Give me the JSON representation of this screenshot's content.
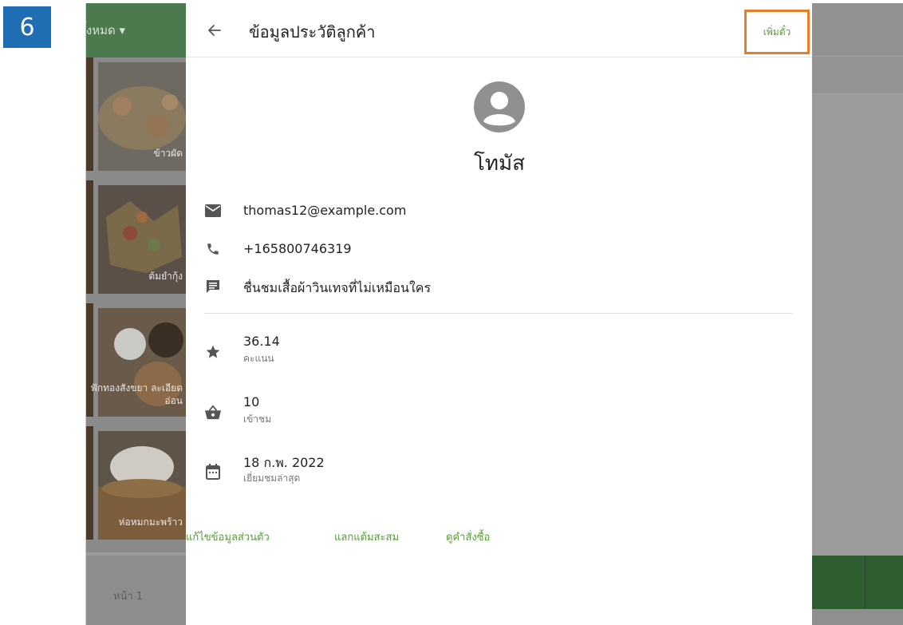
{
  "step": {
    "number": "6"
  },
  "background": {
    "category_label": "ทั้งหมด ▾",
    "menu_items": [
      {
        "label": "ข้าวผัด"
      },
      {
        "label": "ต้มยำกุ้ง"
      },
      {
        "label": "ฟักทองสังขยา ละเอียดอ่อน"
      },
      {
        "label": "ห่อหมกมะพร้าว"
      }
    ],
    "page_label": "หน้า 1"
  },
  "panel": {
    "title": "ข้อมูลประวัติลูกค้า",
    "add_button": "เพิ่มตั๋ว",
    "customer": {
      "name": "โทมัส",
      "email": "thomas12@example.com",
      "phone": "+165800746319",
      "note": "ชื่นชมเสื้อผ้าวินเทจที่ไม่เหมือนใคร"
    },
    "stats": [
      {
        "value": "36.14",
        "label": "คะแนน",
        "icon": "star-icon"
      },
      {
        "value": "10",
        "label": "เข้าชม",
        "icon": "basket-icon"
      },
      {
        "value": "18 ก.พ. 2022",
        "label": "เยี่ยมชมล่าสุด",
        "icon": "calendar-icon"
      }
    ],
    "actions": {
      "edit": "แก้ไขข้อมูลส่วนตัว",
      "redeem": "แลกแต้มสะสม",
      "orders": "ดูคำสั่งซื้อ"
    }
  },
  "colors": {
    "accent_green": "#5b9a3c",
    "highlight_orange": "#e77f2a",
    "step_badge_blue": "#1f6db3"
  }
}
